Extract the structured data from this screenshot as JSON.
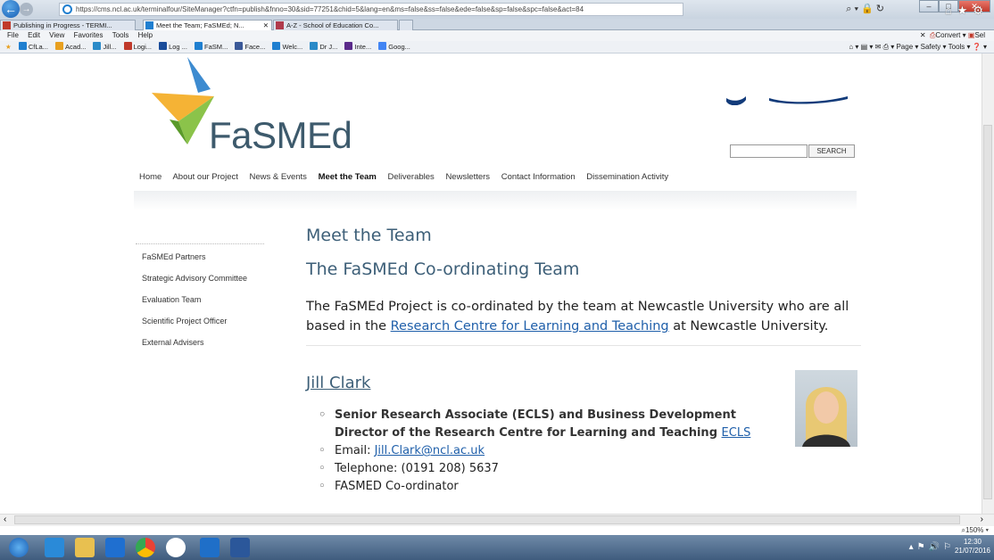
{
  "browser": {
    "url": "https://cms.ncl.ac.uk/terminalfour/SiteManager?ctfn=publish&fnno=30&sid=77251&chid=5&lang=en&ms=false&ss=false&ede=false&sp=false&spc=false&act=84",
    "tabs": [
      {
        "label": "Publishing in Progress - TERMI...",
        "color": "#c0392b"
      },
      {
        "label": "Meet the Team; FaSMEd; N...",
        "color": "#1f7fd0"
      },
      {
        "label": "A-Z - School of Education Co...",
        "color": "#b03a4c"
      }
    ],
    "menu": [
      "File",
      "Edit",
      "View",
      "Favorites",
      "Tools",
      "Help"
    ],
    "convert_label": "Convert",
    "favorites": [
      {
        "label": "CfLa...",
        "color": "#1f7fd0"
      },
      {
        "label": "Acad...",
        "color": "#e8a020"
      },
      {
        "label": "Jill...",
        "color": "#2a8ac8"
      },
      {
        "label": "Logi...",
        "color": "#c0392b"
      },
      {
        "label": "Log ...",
        "color": "#1a4c9a"
      },
      {
        "label": "FaSM...",
        "color": "#1f7fd0"
      },
      {
        "label": "Face...",
        "color": "#3b5998"
      },
      {
        "label": "Welc...",
        "color": "#1f7fd0"
      },
      {
        "label": "Dr J...",
        "color": "#2a8ac8"
      },
      {
        "label": "Inte...",
        "color": "#5a2a8a"
      },
      {
        "label": "Goog...",
        "color": "#4285f4"
      }
    ],
    "command_bar": [
      "Page ▾",
      "Safety ▾",
      "Tools ▾"
    ],
    "zoom": "150%",
    "clock_time": "12:30",
    "clock_date": "21/07/2016"
  },
  "site": {
    "logo_text": "FaSMEd",
    "search_button": "SEARCH",
    "nav": [
      "Home",
      "About our Project",
      "News & Events",
      "Meet the Team",
      "Deliverables",
      "Newsletters",
      "Contact Information",
      "Dissemination Activity"
    ],
    "sidebar": [
      "FaSMEd Partners",
      "Strategic Advisory Committee",
      "Evaluation Team",
      "Scientific Project Officer",
      "External Advisers"
    ]
  },
  "content": {
    "heading": "Meet the Team",
    "subheading": "The FaSMEd Co-ordinating Team",
    "intro_before": "The FaSMEd Project is co-ordinated by the team at Newcastle University who are all based in the ",
    "intro_link": "Research Centre for Learning and Teaching",
    "intro_after": " at Newcastle University.",
    "person": {
      "name": "Jill Clark",
      "role": "Senior Research Associate (ECLS) and Business Development Director of the Research Centre for Learning and Teaching ",
      "role_link": "ECLS",
      "email_label": "Email: ",
      "email": "Jill.Clark@ncl.ac.uk",
      "telephone": "Telephone: (0191 208) 5637",
      "extra": "FASMED Co-ordinator"
    }
  }
}
